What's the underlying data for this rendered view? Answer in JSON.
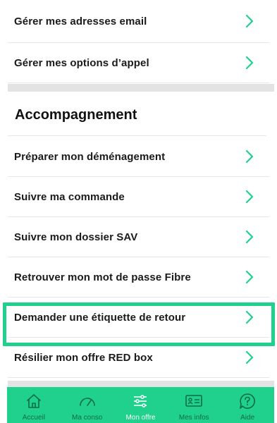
{
  "top_items": [
    {
      "label": "Gérer mes adresses email"
    },
    {
      "label": "Gérer mes options d’appel"
    }
  ],
  "section": {
    "title": "Accompagnement"
  },
  "acc_items": [
    {
      "label": "Préparer mon déménagement"
    },
    {
      "label": "Suivre ma commande"
    },
    {
      "label": "Suivre mon dossier SAV"
    },
    {
      "label": "Retrouver mon mot de passe Fibre"
    },
    {
      "label": "Demander une étiquette de retour"
    },
    {
      "label": "Résilier mon offre RED box"
    }
  ],
  "highlighted_item": "Demander une étiquette de retour",
  "tabbar": {
    "items": [
      {
        "label": "Accueil",
        "icon": "home-icon"
      },
      {
        "label": "Ma conso",
        "icon": "gauge-icon"
      },
      {
        "label": "Mon offre",
        "icon": "sliders-icon",
        "active": true
      },
      {
        "label": "Mes infos",
        "icon": "id-card-icon"
      },
      {
        "label": "Aide",
        "icon": "help-icon"
      }
    ]
  },
  "colors": {
    "accent": "#1fd18c",
    "chevron": "#1fd18c",
    "tab_inactive_text": "#0e6b47",
    "separator": "#e3e3e3"
  }
}
